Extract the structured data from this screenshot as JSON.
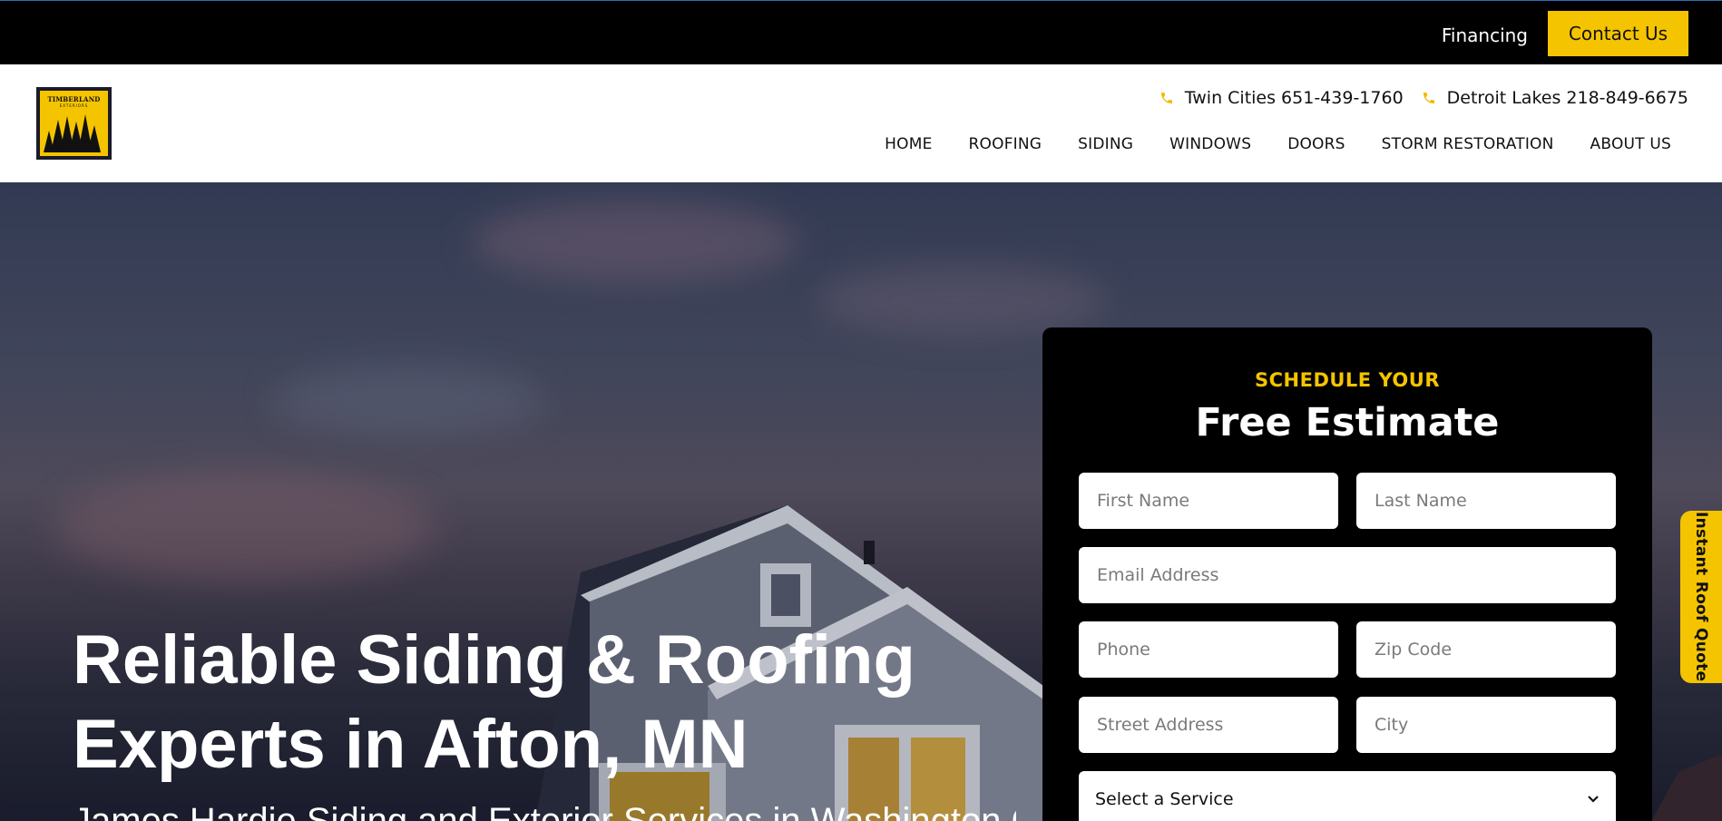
{
  "topbar": {
    "financing_label": "Financing",
    "contact_label": "Contact Us"
  },
  "header": {
    "logo_text": "TIMBERLAND",
    "logo_subtext": "EXTERIORS",
    "phones": [
      {
        "label": "Twin Cities 651-439-1760",
        "icon": "phone-icon"
      },
      {
        "label": "Detroit Lakes 218-849-6675",
        "icon": "phone-icon"
      }
    ],
    "nav": [
      "HOME",
      "ROOFING",
      "SIDING",
      "WINDOWS",
      "DOORS",
      "STORM RESTORATION",
      "ABOUT US"
    ]
  },
  "hero": {
    "title_line1": "Reliable Siding & Roofing",
    "title_line2": "Experts in Afton, MN",
    "subtitle": "James Hardie Siding and Exterior Services in Washington County"
  },
  "form": {
    "kicker": "SCHEDULE YOUR",
    "title": "Free Estimate",
    "placeholders": {
      "first_name": "First Name",
      "last_name": "Last Name",
      "email": "Email Address",
      "phone": "Phone",
      "zip": "Zip Code",
      "street": "Street Address",
      "city": "City"
    },
    "service_select": "Select a Service"
  },
  "side_tab_label": "Instant Roof Quote",
  "colors": {
    "accent": "#f5c400",
    "topbar_bg": "#000000",
    "form_bg": "#000000"
  }
}
